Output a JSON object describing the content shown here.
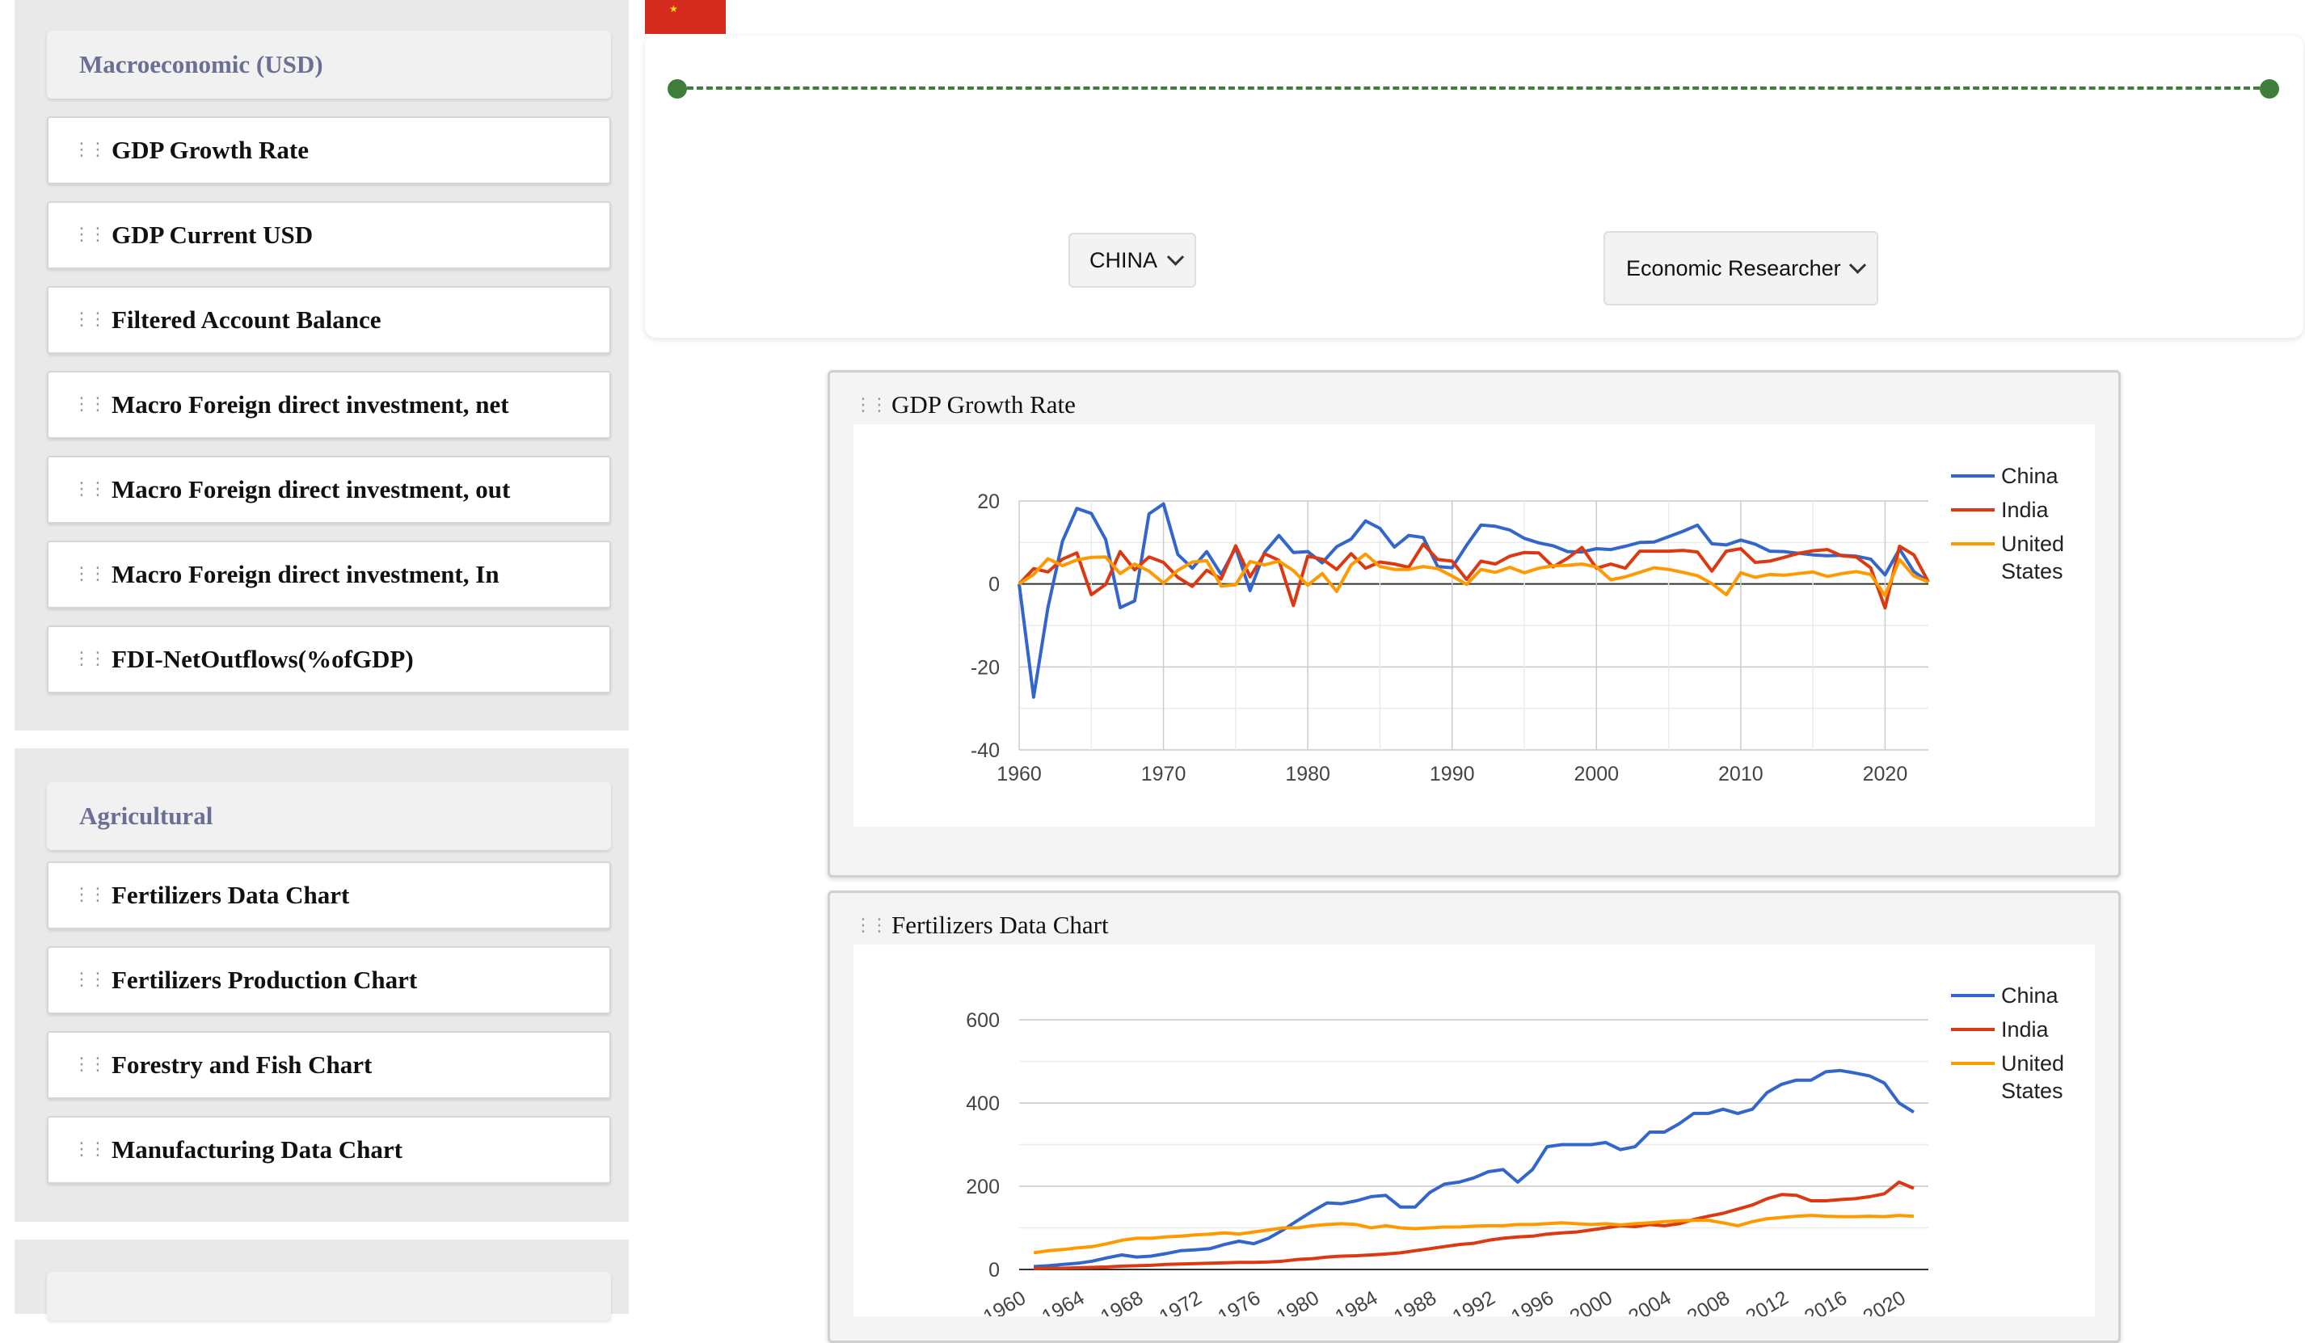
{
  "sidebar": {
    "macro": {
      "header": "Macroeconomic (USD)",
      "items": [
        {
          "label": "GDP Growth Rate"
        },
        {
          "label": "GDP Current USD"
        },
        {
          "label": "Filtered Account Balance"
        },
        {
          "label": "Macro Foreign direct investment, net"
        },
        {
          "label": "Macro Foreign direct investment, out"
        },
        {
          "label": "Macro Foreign direct investment, In"
        },
        {
          "label": "FDI-NetOutflows(%ofGDP)"
        }
      ]
    },
    "agri": {
      "header": "Agricultural",
      "items": [
        {
          "label": "Fertilizers Data Chart"
        },
        {
          "label": "Fertilizers Production Chart"
        },
        {
          "label": "Forestry and Fish Chart"
        },
        {
          "label": "Manufacturing Data Chart"
        }
      ]
    }
  },
  "controls": {
    "country_select": "CHINA",
    "role_select": "Economic Researcher"
  },
  "colors": {
    "china": "#3366cc",
    "india": "#dc3912",
    "us": "#ff9900",
    "timeline": "#3f7d3a",
    "flag": "#d52b1e"
  },
  "icons": {
    "grip": "drag-handle-icon",
    "flag": "china-flag-icon",
    "chevron": "chevron-down-icon"
  },
  "chart_data": [
    {
      "type": "line",
      "title": "GDP Growth Rate",
      "x_ticks": [
        1960,
        1970,
        1980,
        1990,
        2000,
        2010,
        2020
      ],
      "y_ticks": [
        20,
        0,
        -20,
        -40
      ],
      "xlim": [
        1960,
        2023
      ],
      "ylim": [
        -40,
        20
      ],
      "legend": [
        {
          "name": "China"
        },
        {
          "name": "India"
        },
        {
          "name": "United",
          "name2": "States"
        }
      ],
      "legend_position": "right",
      "x": [
        1960,
        1961,
        1962,
        1963,
        1964,
        1965,
        1966,
        1967,
        1968,
        1969,
        1970,
        1971,
        1972,
        1973,
        1974,
        1975,
        1976,
        1977,
        1978,
        1979,
        1980,
        1981,
        1982,
        1983,
        1984,
        1985,
        1986,
        1987,
        1988,
        1989,
        1990,
        1991,
        1992,
        1993,
        1994,
        1995,
        1996,
        1997,
        1998,
        1999,
        2000,
        2001,
        2002,
        2003,
        2004,
        2005,
        2006,
        2007,
        2008,
        2009,
        2010,
        2011,
        2012,
        2013,
        2014,
        2015,
        2016,
        2017,
        2018,
        2019,
        2020,
        2021,
        2022,
        2023
      ],
      "series": [
        {
          "name": "China",
          "values": [
            0,
            -27.3,
            -5.6,
            10.3,
            18.2,
            17.0,
            10.7,
            -5.7,
            -4.1,
            16.9,
            19.3,
            7.1,
            3.8,
            7.8,
            2.3,
            8.7,
            -1.6,
            7.6,
            11.7,
            7.6,
            7.8,
            5.1,
            9.0,
            10.8,
            15.2,
            13.4,
            8.9,
            11.7,
            11.2,
            4.2,
            3.9,
            9.3,
            14.2,
            13.9,
            13.0,
            11.0,
            9.9,
            9.2,
            7.8,
            7.7,
            8.5,
            8.3,
            9.1,
            10.0,
            10.1,
            11.4,
            12.7,
            14.2,
            9.7,
            9.4,
            10.6,
            9.6,
            7.9,
            7.8,
            7.4,
            7.0,
            6.8,
            6.9,
            6.7,
            6.0,
            2.2,
            8.4,
            3.0,
            0.5
          ]
        },
        {
          "name": "India",
          "values": [
            0,
            3.7,
            2.9,
            6.0,
            7.5,
            -2.6,
            -0.1,
            7.8,
            3.4,
            6.5,
            5.2,
            1.6,
            -0.6,
            3.3,
            1.2,
            9.2,
            1.7,
            7.3,
            5.7,
            -5.2,
            6.7,
            6.0,
            3.5,
            7.3,
            3.8,
            5.3,
            4.8,
            4.0,
            9.6,
            5.9,
            5.5,
            1.1,
            5.5,
            4.8,
            6.7,
            7.6,
            7.5,
            4.1,
            6.2,
            8.8,
            3.8,
            4.8,
            3.8,
            7.9,
            7.9,
            7.9,
            8.1,
            7.7,
            3.1,
            7.9,
            8.5,
            5.2,
            5.5,
            6.4,
            7.4,
            8.0,
            8.3,
            6.8,
            6.5,
            3.9,
            -5.8,
            9.1,
            7.0,
            0.5
          ]
        },
        {
          "name": "United States",
          "values": [
            0,
            2.3,
            6.1,
            4.4,
            5.8,
            6.4,
            6.5,
            2.5,
            4.8,
            3.1,
            0.2,
            3.3,
            5.3,
            5.6,
            -0.5,
            -0.2,
            5.4,
            4.6,
            5.5,
            3.2,
            -0.3,
            2.5,
            -1.8,
            4.6,
            7.2,
            4.2,
            3.5,
            3.5,
            4.2,
            3.7,
            1.9,
            -0.1,
            3.5,
            2.8,
            4.0,
            2.7,
            3.8,
            4.4,
            4.5,
            4.8,
            4.1,
            1.0,
            1.7,
            2.8,
            3.9,
            3.5,
            2.8,
            2.0,
            0.1,
            -2.6,
            2.7,
            1.6,
            2.3,
            2.1,
            2.5,
            2.9,
            1.8,
            2.5,
            3.0,
            2.3,
            -2.8,
            5.9,
            1.9,
            0.5
          ]
        }
      ]
    },
    {
      "type": "line",
      "title": "Fertilizers Data Chart",
      "x_ticks": [
        1960,
        1964,
        1968,
        1972,
        1976,
        1980,
        1984,
        1988,
        1992,
        1996,
        2000,
        2004,
        2008,
        2012,
        2016,
        2020
      ],
      "y_ticks": [
        600,
        400,
        200,
        0
      ],
      "xlim": [
        1960,
        2022
      ],
      "ylim": [
        0,
        600
      ],
      "legend": [
        {
          "name": "China"
        },
        {
          "name": "India"
        },
        {
          "name": "United",
          "name2": "States"
        }
      ],
      "legend_position": "right",
      "x": [
        1961,
        1962,
        1963,
        1964,
        1965,
        1966,
        1967,
        1968,
        1969,
        1970,
        1971,
        1972,
        1973,
        1974,
        1975,
        1976,
        1977,
        1978,
        1979,
        1980,
        1981,
        1982,
        1983,
        1984,
        1985,
        1986,
        1987,
        1988,
        1989,
        1990,
        1991,
        1992,
        1993,
        1994,
        1995,
        1996,
        1997,
        1998,
        1999,
        2000,
        2001,
        2002,
        2003,
        2004,
        2005,
        2006,
        2007,
        2008,
        2009,
        2010,
        2011,
        2012,
        2013,
        2014,
        2015,
        2016,
        2017,
        2018,
        2019,
        2020,
        2021
      ],
      "series": [
        {
          "name": "China",
          "values": [
            7,
            9,
            12,
            15,
            20,
            28,
            35,
            30,
            32,
            38,
            45,
            47,
            50,
            60,
            68,
            62,
            75,
            95,
            118,
            140,
            160,
            158,
            165,
            175,
            178,
            150,
            150,
            185,
            205,
            210,
            220,
            235,
            240,
            210,
            240,
            295,
            300,
            300,
            300,
            305,
            288,
            295,
            330,
            330,
            350,
            375,
            375,
            385,
            375,
            385,
            425,
            445,
            455,
            455,
            475,
            478,
            472,
            465,
            448,
            400,
            378
          ]
        },
        {
          "name": "India",
          "values": [
            2,
            3,
            3,
            4,
            5,
            6,
            8,
            9,
            10,
            12,
            13,
            14,
            15,
            16,
            17,
            17,
            18,
            20,
            24,
            26,
            30,
            32,
            33,
            35,
            37,
            40,
            45,
            50,
            55,
            60,
            63,
            70,
            75,
            78,
            80,
            85,
            88,
            90,
            95,
            100,
            105,
            103,
            108,
            105,
            110,
            120,
            128,
            135,
            145,
            155,
            170,
            180,
            178,
            165,
            165,
            168,
            170,
            175,
            182,
            210,
            195
          ]
        },
        {
          "name": "United States",
          "values": [
            40,
            45,
            48,
            52,
            55,
            62,
            70,
            75,
            75,
            78,
            80,
            83,
            85,
            88,
            85,
            90,
            95,
            100,
            100,
            105,
            108,
            110,
            108,
            100,
            105,
            100,
            98,
            100,
            102,
            102,
            104,
            105,
            105,
            108,
            108,
            110,
            112,
            110,
            108,
            110,
            107,
            110,
            112,
            115,
            117,
            118,
            118,
            112,
            105,
            115,
            122,
            125,
            128,
            130,
            128,
            127,
            127,
            128,
            127,
            130,
            128
          ]
        }
      ]
    }
  ]
}
